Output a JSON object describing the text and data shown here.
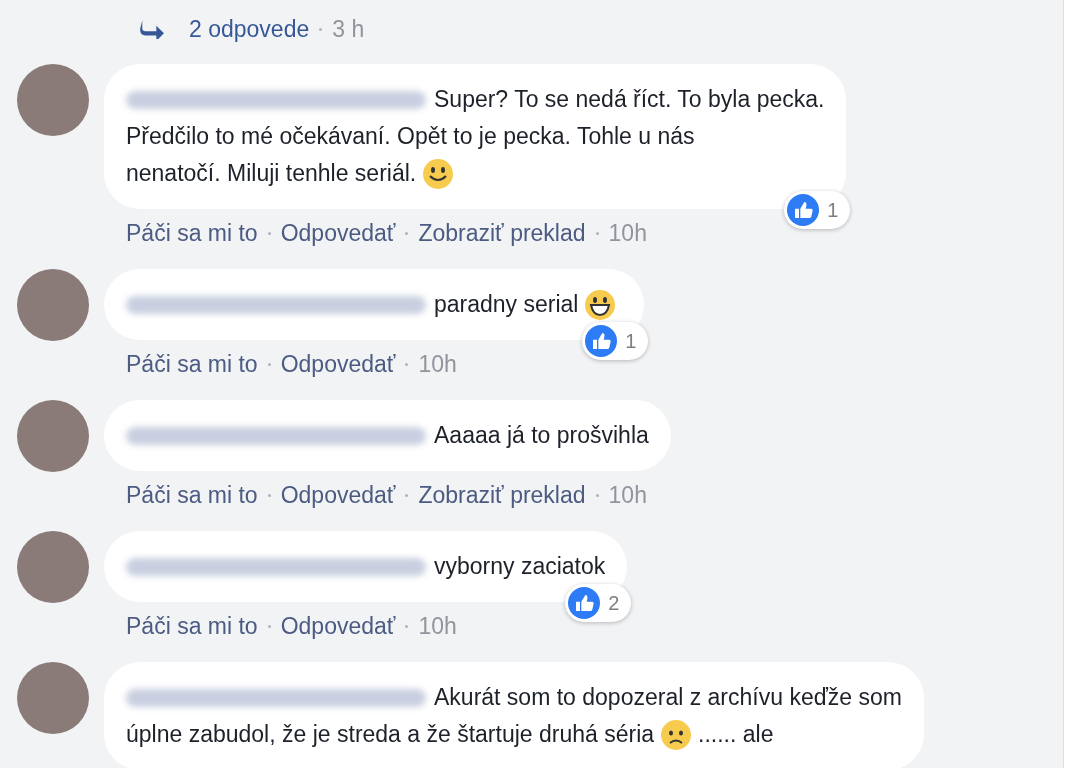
{
  "replies_link": {
    "label": "2 odpovede",
    "time": "3 h"
  },
  "comments": [
    {
      "lines": [
        [
          {
            "kind": "text",
            "text": "Super? To se nedá říct. To byla pecka."
          }
        ],
        [
          {
            "kind": "text",
            "text": "Předčilo to mé očekávaní. Opět to je pecka. Tohle u nás"
          }
        ],
        [
          {
            "kind": "text",
            "text": "nenatočí. Miluji tenhle seriál."
          },
          {
            "kind": "smile"
          }
        ]
      ],
      "reaction_count": "1",
      "actions": [
        "Páči sa mi to",
        "Odpovedať",
        "Zobraziť preklad"
      ],
      "time": "10h"
    },
    {
      "lines": [
        [
          {
            "kind": "text",
            "text": "paradny serial"
          },
          {
            "kind": "grin"
          }
        ]
      ],
      "reaction_count": "1",
      "actions": [
        "Páči sa mi to",
        "Odpovedať"
      ],
      "time": "10h"
    },
    {
      "lines": [
        [
          {
            "kind": "text",
            "text": "Aaaaa já to prošvihla"
          }
        ]
      ],
      "actions": [
        "Páči sa mi to",
        "Odpovedať",
        "Zobraziť preklad"
      ],
      "time": "10h"
    },
    {
      "lines": [
        [
          {
            "kind": "text",
            "text": "vyborny zaciatok"
          }
        ]
      ],
      "reaction_count": "2",
      "actions": [
        "Páči sa mi to",
        "Odpovedať"
      ],
      "time": "10h"
    },
    {
      "lines": [
        [
          {
            "kind": "text",
            "text": "Akurát som to dopozeral z archívu keďže som"
          }
        ],
        [
          {
            "kind": "text",
            "text": "úplne zabudol, že je streda a že štartuje druhá séria"
          },
          {
            "kind": "sad"
          },
          {
            "kind": "text",
            "text": "...... ale"
          }
        ]
      ]
    }
  ]
}
